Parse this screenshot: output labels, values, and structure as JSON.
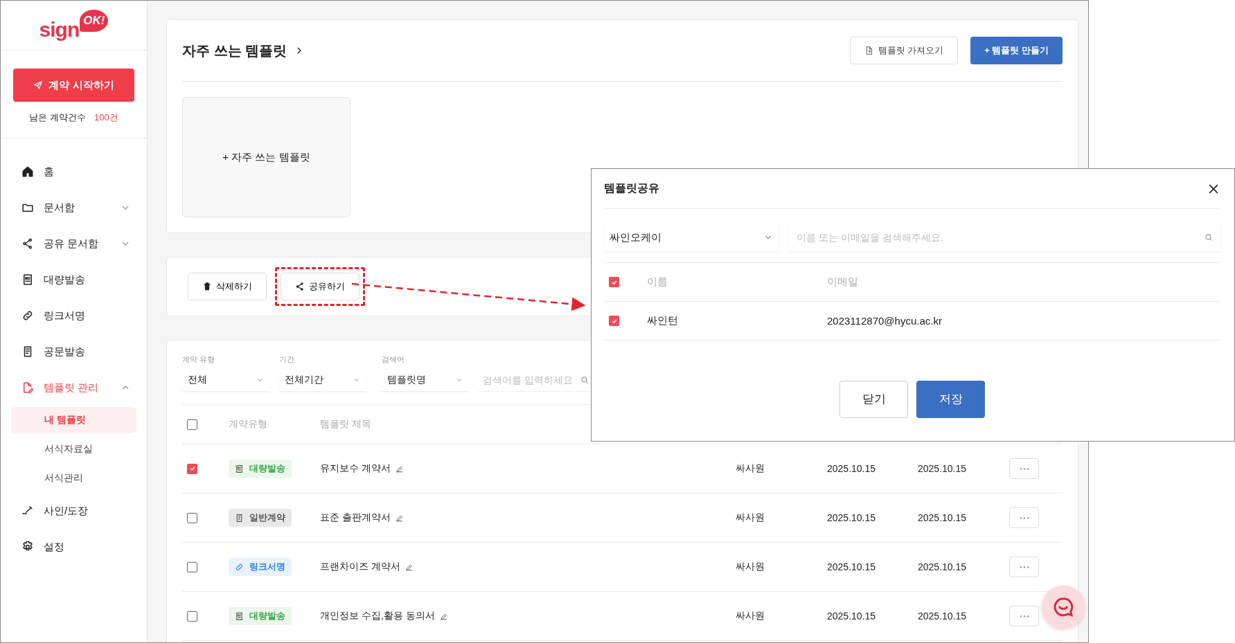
{
  "sidebar": {
    "logo": {
      "text": "sign",
      "badge": "OK!"
    },
    "start_button": "계약 시작하기",
    "remaining": {
      "label": "남은 계약건수",
      "count": "100건"
    },
    "items": [
      {
        "label": "홈",
        "selected": false
      },
      {
        "label": "문서함",
        "selected": false,
        "expanded": false
      },
      {
        "label": "공유 문서함",
        "selected": false,
        "expanded": false
      },
      {
        "label": "대량발송",
        "selected": false
      },
      {
        "label": "링크서명",
        "selected": false
      },
      {
        "label": "공문발송",
        "selected": false
      },
      {
        "label": "템플릿 관리",
        "selected": true,
        "expanded": true,
        "children": [
          {
            "label": "내 템플릿",
            "selected": true
          },
          {
            "label": "서식자료실",
            "selected": false
          },
          {
            "label": "서식관리",
            "selected": false
          }
        ]
      },
      {
        "label": "사인/도장",
        "selected": false
      },
      {
        "label": "설정",
        "selected": false
      }
    ]
  },
  "favorites": {
    "title": "자주 쓰는 템플릿",
    "buttons": [
      {
        "label": "템플릿 가져오기",
        "kind": "outline"
      },
      {
        "label": "+ 템플릿 만들기",
        "kind": "primary"
      }
    ],
    "add_tile": "+ 자주 쓰는 템플릿"
  },
  "actions": [
    {
      "label": "삭제하기",
      "highlighted": false
    },
    {
      "label": "공유하기",
      "highlighted": true
    }
  ],
  "filters": [
    {
      "label": "계약 유형",
      "value": "전체"
    },
    {
      "label": "기간",
      "value": "전체기간"
    },
    {
      "label": "검색어",
      "value": "템플릿명"
    }
  ],
  "search": {
    "placeholder": "검색어를 입력하세요"
  },
  "table": {
    "all_checked": false,
    "columns": [
      "계약유형",
      "템플릿 제목"
    ],
    "rows": [
      {
        "checked": true,
        "type": {
          "label": "대량발송",
          "kind": "bulk"
        },
        "title": "유지보수 계약서",
        "column_3": "싸사원",
        "column_4": "2025.10.15",
        "column_5": "2025.10.15"
      },
      {
        "checked": false,
        "type": {
          "label": "일반계약",
          "kind": "general"
        },
        "title": "표준 출판계약서",
        "column_3": "싸사원",
        "column_4": "2025.10.15",
        "column_5": "2025.10.15"
      },
      {
        "checked": false,
        "type": {
          "label": "링크서명",
          "kind": "link"
        },
        "title": "프랜차이즈 계약서",
        "column_3": "싸사원",
        "column_4": "2025.10.15",
        "column_5": "2025.10.15"
      },
      {
        "checked": false,
        "type": {
          "label": "대량발송",
          "kind": "bulk"
        },
        "title": "개인정보 수집,활용 동의서",
        "column_3": "싸사원",
        "column_4": "2025.10.15",
        "column_5": "2025.10.15"
      }
    ]
  },
  "modal": {
    "title": "템플릿공유",
    "org_select": "싸인오케이",
    "search": {
      "placeholder": "이름 또는 이메일을 검색해주세요."
    },
    "columns": [
      "이름",
      "이메일"
    ],
    "all_checked": true,
    "rows": [
      {
        "checked": true,
        "name": "싸인턴",
        "email": "2023112870@hycu.ac.kr"
      }
    ],
    "buttons": [
      {
        "label": "닫기",
        "kind": "secondary"
      },
      {
        "label": "저장",
        "kind": "primary"
      }
    ]
  }
}
